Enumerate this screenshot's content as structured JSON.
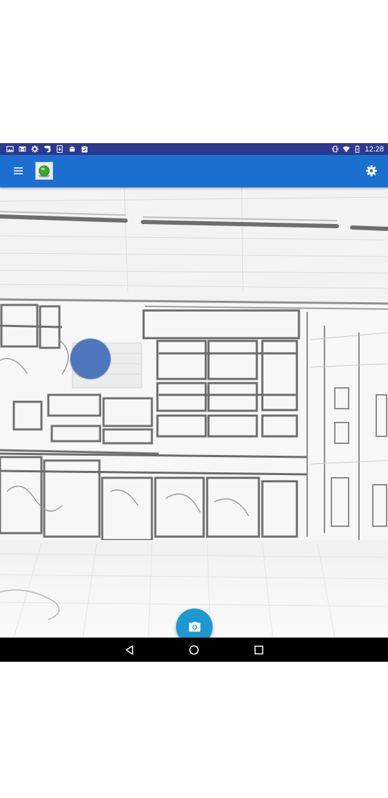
{
  "status_bar": {
    "time": "12:28",
    "background": "#2b3990",
    "left_icons": [
      "image-icon",
      "gmail-icon",
      "settings-cog-icon",
      "evernote-icon",
      "download-icon",
      "android-icon",
      "clipboard-icon"
    ],
    "right_icons": [
      "vibrate-icon",
      "wifi-icon",
      "battery-icon"
    ]
  },
  "app_bar": {
    "background": "#1a6fcf",
    "menu_icon": "hamburger-menu-icon",
    "logo_icon": "green-ball-logo-icon",
    "settings_icon": "gear-icon"
  },
  "viewport": {
    "content": "camera-preview",
    "marker_color": "#4f77bd"
  },
  "fabs": {
    "camera": {
      "icon": "camera-icon",
      "color": "#1e98d0"
    },
    "add": {
      "icon": "plus-icon",
      "color": "#f5407a"
    },
    "play": {
      "icon": "play-icon",
      "color": "#f68a1e"
    }
  },
  "nav_bar": {
    "buttons": [
      "back-icon",
      "home-icon",
      "recents-icon"
    ]
  }
}
